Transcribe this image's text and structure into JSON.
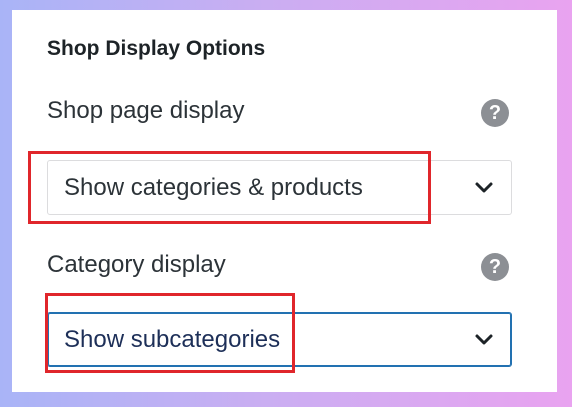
{
  "section": {
    "title": "Shop Display Options"
  },
  "shop_page_display": {
    "label": "Shop page display",
    "help_icon": "question-mark-circle",
    "help_glyph": "?",
    "selected_value": "Show categories & products",
    "dropdown_icon": "chevron-down"
  },
  "category_display": {
    "label": "Category display",
    "help_icon": "question-mark-circle",
    "help_glyph": "?",
    "selected_value": "Show subcategories",
    "dropdown_icon": "chevron-down",
    "focused": true
  },
  "colors": {
    "highlight": "#e0262b",
    "focus_border": "#2271b1",
    "help_icon": "#8c8f94"
  }
}
